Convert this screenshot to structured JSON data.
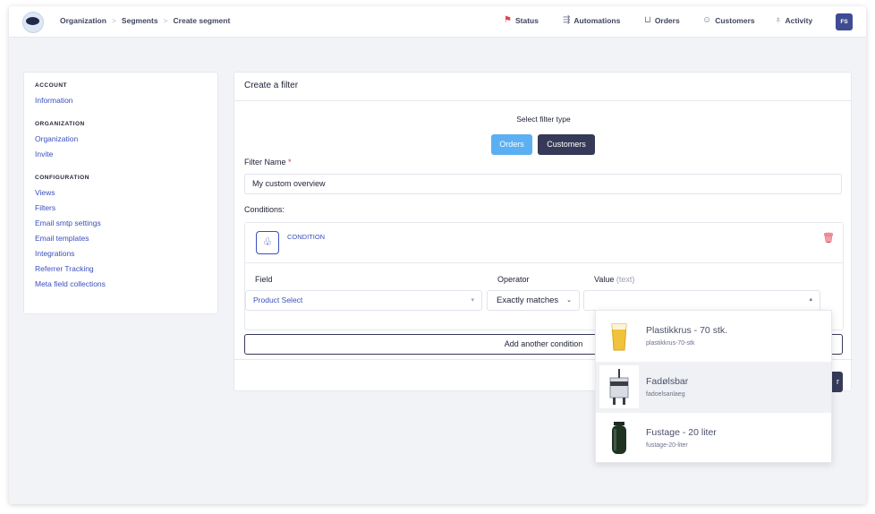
{
  "breadcrumb": [
    "Organization",
    "Segments",
    "Create segment"
  ],
  "breadcrumb_sep": ">",
  "nav": {
    "status": "Status",
    "automations": "Automations",
    "orders": "Orders",
    "customers": "Customers",
    "activity": "Activity"
  },
  "avatar": "FS",
  "sidebar": {
    "account_title": "ACCOUNT",
    "account_items": [
      "Information"
    ],
    "organization_title": "ORGANIZATION",
    "organization_items": [
      "Organization",
      "Invite"
    ],
    "configuration_title": "CONFIGURATION",
    "configuration_items": [
      "Views",
      "Filters",
      "Email smtp settings",
      "Email templates",
      "Integrations",
      "Referrer Tracking",
      "Meta field collections"
    ]
  },
  "main": {
    "title": "Create a filter",
    "select_type_label": "Select filter type",
    "orders_label": "Orders",
    "customers_label": "Customers",
    "filter_name_label": "Filter Name",
    "required_mark": "*",
    "filter_name_value": "My custom overview",
    "conditions_label": "Conditions:",
    "condition_title": "CONDITION",
    "field_label": "Field",
    "operator_label": "Operator",
    "value_label": "Value",
    "value_hint": "(text)",
    "field_value": "Product Select",
    "operator_value": "Exactly matches",
    "add_condition_label": "Add another condition",
    "save_label": "r"
  },
  "dropdown": {
    "options": [
      {
        "title": "Plastikkrus - 70 stk.",
        "sub": "plastikkrus-70-stk"
      },
      {
        "title": "Fadølsbar",
        "sub": "fadoelsanlaeg"
      },
      {
        "title": "Fustage - 20 liter",
        "sub": "fustage-20-liter"
      }
    ]
  },
  "colors": {
    "accent": "#3b4fbd",
    "orders_button": "#5ab0f2",
    "dark_button": "#363a58",
    "danger": "#e0424e"
  }
}
